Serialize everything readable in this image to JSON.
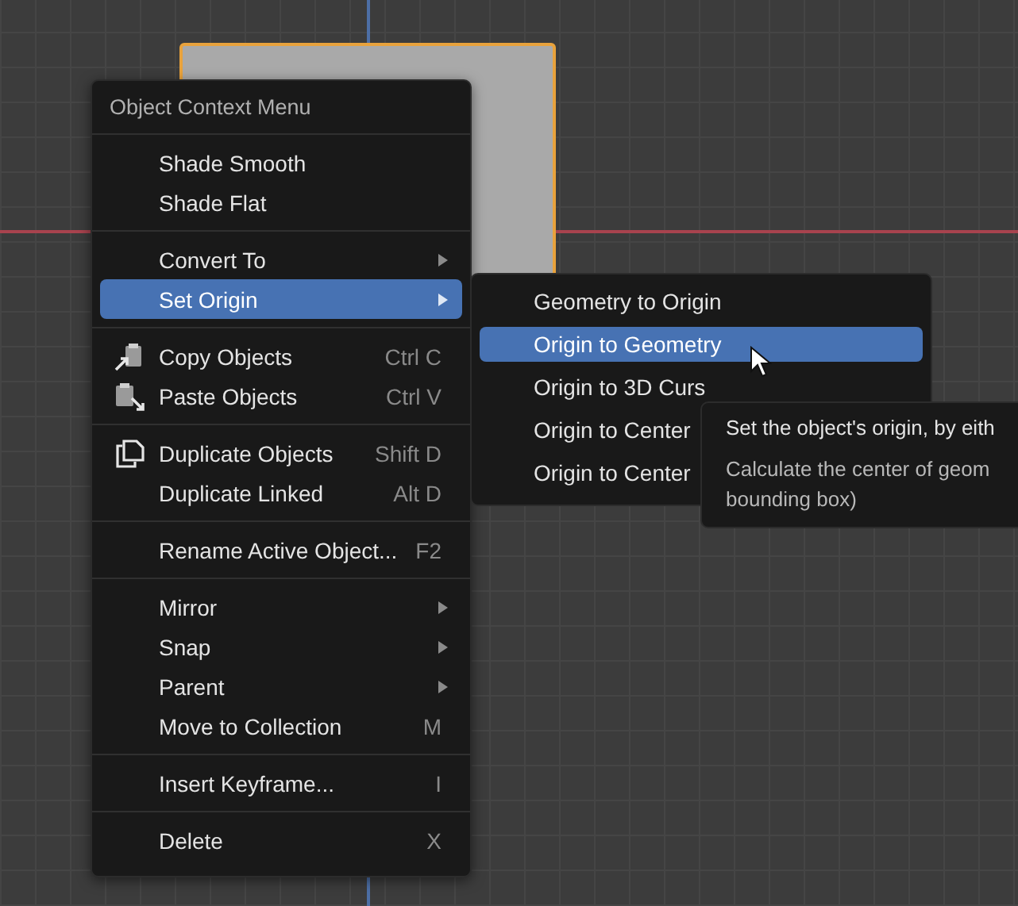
{
  "menu": {
    "title": "Object Context Menu",
    "sections": [
      [
        {
          "label": "Shade Smooth",
          "selected": false,
          "submenu": false
        },
        {
          "label": "Shade Flat",
          "selected": false,
          "submenu": false
        }
      ],
      [
        {
          "label": "Convert To",
          "selected": false,
          "submenu": true
        },
        {
          "label": "Set Origin",
          "selected": true,
          "submenu": true
        }
      ],
      [
        {
          "label": "Copy Objects",
          "shortcut": "Ctrl C",
          "kind": "copy",
          "selected": false,
          "submenu": false
        },
        {
          "label": "Paste Objects",
          "shortcut": "Ctrl V",
          "kind": "paste",
          "selected": false,
          "submenu": false
        }
      ],
      [
        {
          "label": "Duplicate Objects",
          "shortcut": "Shift D",
          "kind": "duplicate",
          "selected": false,
          "submenu": false
        },
        {
          "label": "Duplicate Linked",
          "shortcut": "Alt D",
          "selected": false,
          "submenu": false
        }
      ],
      [
        {
          "label": "Rename Active Object...",
          "shortcut": "F2",
          "selected": false,
          "submenu": false
        }
      ],
      [
        {
          "label": "Mirror",
          "selected": false,
          "submenu": true
        },
        {
          "label": "Snap",
          "selected": false,
          "submenu": true
        },
        {
          "label": "Parent",
          "selected": false,
          "submenu": true
        },
        {
          "label": "Move to Collection",
          "shortcut": "M",
          "selected": false,
          "submenu": false
        }
      ],
      [
        {
          "label": "Insert Keyframe...",
          "shortcut": "I",
          "selected": false,
          "submenu": false
        }
      ],
      [
        {
          "label": "Delete",
          "shortcut": "X",
          "selected": false,
          "submenu": false
        }
      ]
    ]
  },
  "submenu": {
    "items": [
      {
        "label": "Geometry to Origin",
        "selected": false
      },
      {
        "label": "Origin to Geometry",
        "selected": true
      },
      {
        "label": "Origin to 3D Curs",
        "selected": false
      },
      {
        "label": "Origin to Center",
        "selected": false
      },
      {
        "label": "Origin to Center",
        "selected": false
      }
    ]
  },
  "tooltip": {
    "title": "Set the object's origin, by eith",
    "description": [
      "Calculate the center of geom",
      "bounding box)"
    ]
  }
}
